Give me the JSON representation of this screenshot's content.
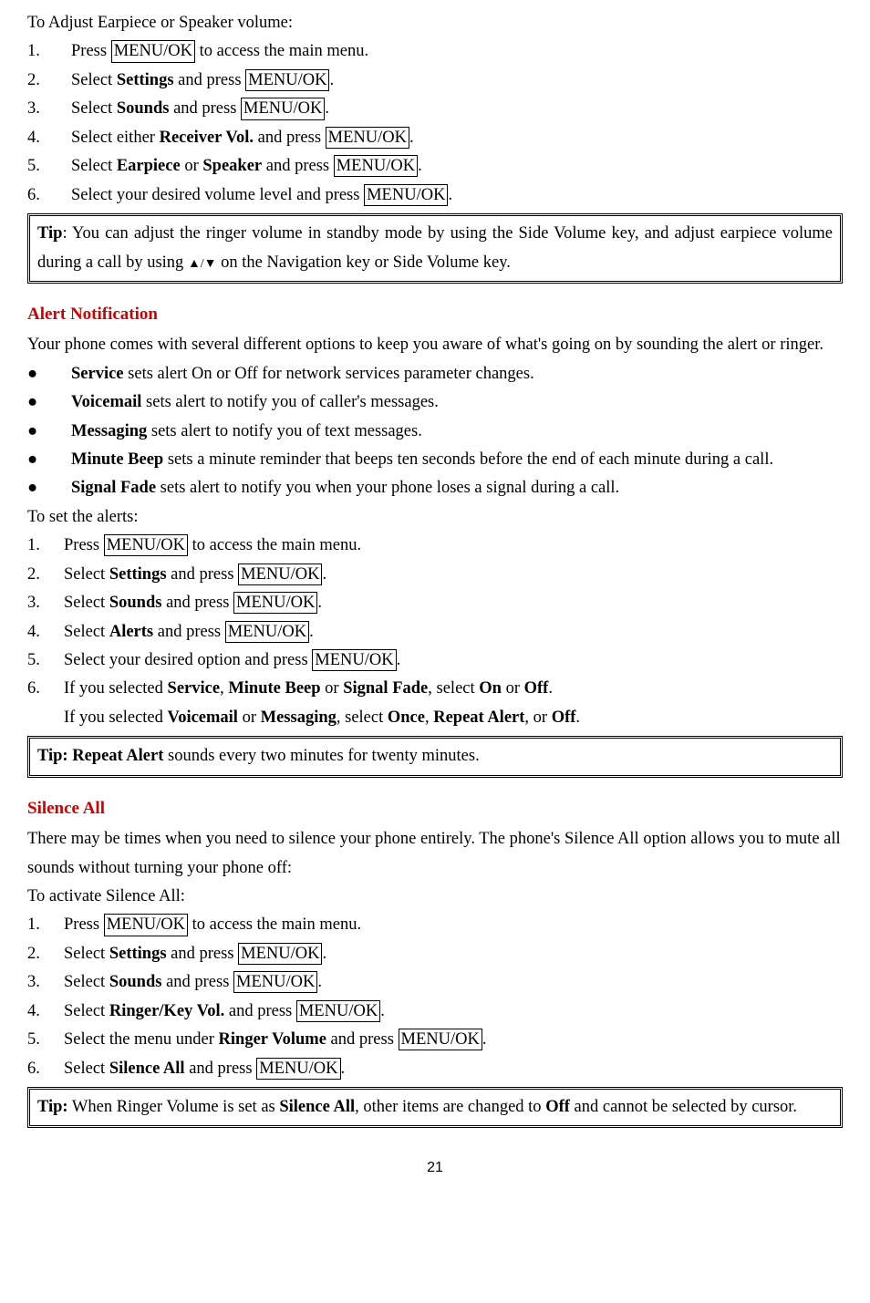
{
  "menuok": "MENU/OK",
  "section1": {
    "title": "To Adjust Earpiece or Speaker volume:",
    "steps": [
      {
        "n": "1.",
        "pre": "Press ",
        "mid": "",
        "post": " to access the main menu.",
        "bolds": []
      },
      {
        "n": "2.",
        "pre": "Select ",
        "b1": "Settings",
        "mid": " and press ",
        "post": "."
      },
      {
        "n": "3.",
        "pre": "Select ",
        "b1": "Sounds",
        "mid": " and press ",
        "post": "."
      },
      {
        "n": "4.",
        "pre": "Select either ",
        "b1": "Receiver Vol.",
        "mid": " and press ",
        "post": "."
      },
      {
        "n": "5.",
        "pre": "Select ",
        "b1": "Earpiece",
        "mid2": " or ",
        "b2": "Speaker",
        "mid": " and press ",
        "post": "."
      },
      {
        "n": "6.",
        "pre": "Select your desired volume level and press ",
        "post": "."
      }
    ],
    "tip_label": "Tip",
    "tip_a": ": You can adjust the ringer volume in standby mode by using the Side Volume key, and adjust earpiece volume during a call by using ",
    "tip_triangles": "▲/▼",
    "tip_b": "  on the Navigation key or Side Volume key."
  },
  "section2": {
    "heading": "Alert Notification",
    "intro": "Your phone comes with several different options to keep you aware of what's going on by sounding the alert or ringer.",
    "bullets": [
      {
        "b": "Service",
        "rest": " sets alert On or Off for network services parameter changes."
      },
      {
        "b": "Voicemail",
        "rest": " sets alert to notify you of caller's messages."
      },
      {
        "b": "Messaging",
        "rest": " sets alert to notify you of text messages."
      },
      {
        "b": "Minute Beep",
        "rest": " sets a minute reminder that beeps ten seconds before the end of each minute during a call."
      },
      {
        "b": "Signal Fade",
        "rest": " sets alert to notify you when your phone loses a signal during a call."
      }
    ],
    "steps_title": "To set the alerts:",
    "steps": [
      {
        "n": "1.",
        "pre": "Press ",
        "post": " to access the main menu."
      },
      {
        "n": "2.",
        "pre": "Select ",
        "b1": "Settings",
        "mid": " and press ",
        "post": "."
      },
      {
        "n": "3.",
        "pre": "Select ",
        "b1": "Sounds",
        "mid": " and press ",
        "post": "."
      },
      {
        "n": "4.",
        "pre": "Select ",
        "b1": "Alerts",
        "mid": " and press ",
        "post": "."
      },
      {
        "n": "5.",
        "pre": "Select your desired option and press ",
        "post": "."
      }
    ],
    "step6_n": "6.",
    "step6_a": "If you selected ",
    "step6_service": "Service",
    "step6_comma1": ", ",
    "step6_minute": "Minute Beep",
    "step6_or1": " or ",
    "step6_fade": "Signal Fade",
    "step6_sel1": ", select ",
    "step6_on": "On",
    "step6_or2": " or ",
    "step6_off": "Off",
    "step6_dot1": ".",
    "step6b_a": "If you selected ",
    "step6b_vm": "Voicemail",
    "step6b_or": " or ",
    "step6b_msg": "Messaging",
    "step6b_sel": ", select ",
    "step6b_once": "Once",
    "step6b_c1": ", ",
    "step6b_rep": "Repeat Alert",
    "step6b_c2": ", or ",
    "step6b_off": "Off",
    "step6b_dot": ".",
    "tip_label": "Tip: Repeat Alert",
    "tip_rest": " sounds every two minutes for twenty minutes."
  },
  "section3": {
    "heading": "Silence All",
    "intro": "There may be times when you need to silence your phone entirely. The phone's Silence All option allows you to mute all sounds without turning your phone off:",
    "steps_title": "To activate Silence All:",
    "steps": [
      {
        "n": "1.",
        "pre": "Press ",
        "post": " to access the main menu."
      },
      {
        "n": "2.",
        "pre": "Select ",
        "b1": "Settings",
        "mid": " and press ",
        "post": "."
      },
      {
        "n": "3.",
        "pre": "Select ",
        "b1": "Sounds",
        "mid": " and press ",
        "post": "."
      },
      {
        "n": "4.",
        "pre": "Select ",
        "b1": "Ringer/Key Vol.",
        "mid": " and press ",
        "post": "."
      },
      {
        "n": "5.",
        "pre": " Select the menu under ",
        "b1": "Ringer Volume",
        "mid": " and press ",
        "post": "."
      },
      {
        "n": "6.",
        "pre": "Select ",
        "b1": "Silence All",
        "mid": " and press ",
        "post": "."
      }
    ],
    "tip_label": "Tip:",
    "tip_a": " When Ringer Volume is set as ",
    "tip_b1": "Silence All",
    "tip_b": ", other items are changed to ",
    "tip_b2": "Off",
    "tip_c": " and cannot be selected by cursor."
  },
  "page_number": "21"
}
